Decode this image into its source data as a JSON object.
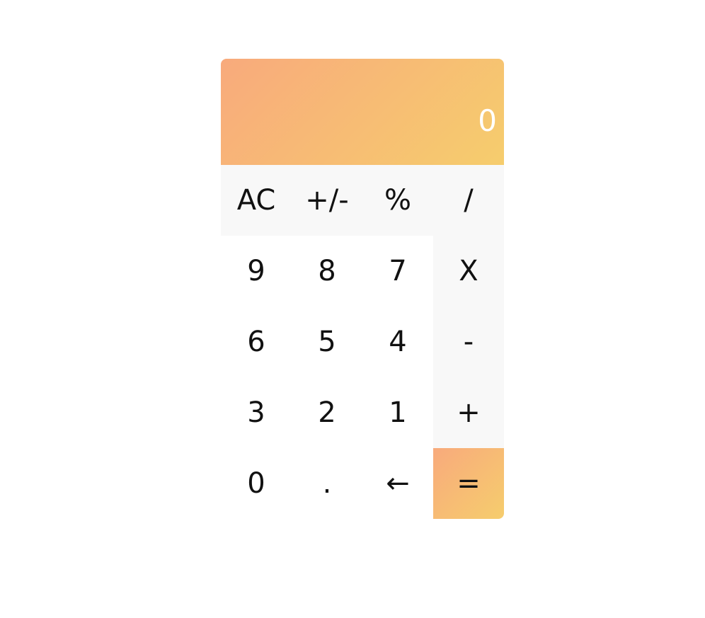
{
  "display": {
    "value": "0"
  },
  "keys": {
    "ac": "AC",
    "toggle_sign": "+/-",
    "percent": "%",
    "divide": "/",
    "nine": "9",
    "eight": "8",
    "seven": "7",
    "multiply": "X",
    "six": "6",
    "five": "5",
    "four": "4",
    "subtract": "-",
    "three": "3",
    "two": "2",
    "one": "1",
    "add": "+",
    "zero": "0",
    "decimal": ".",
    "backspace": "←",
    "equals": "="
  },
  "colors": {
    "accent_start": "#f8aa7c",
    "accent_end": "#f6cd6d",
    "operator_bg": "#f8f8f8",
    "display_text": "#ffffff"
  }
}
